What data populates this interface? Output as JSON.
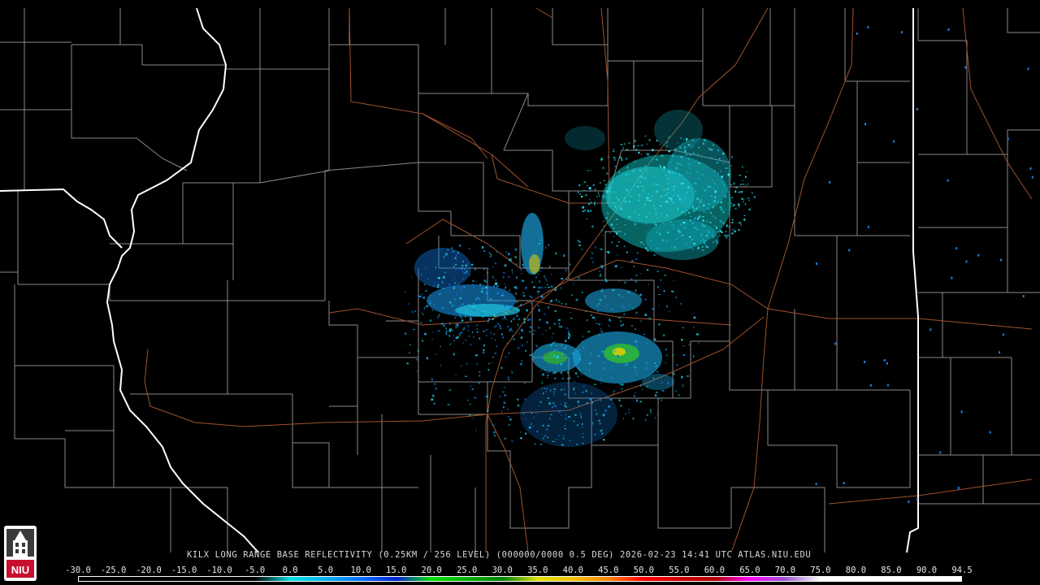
{
  "radar": {
    "header": "KILX LONG RANGE BASE REFLECTIVITY (0.25KM / 256 LEVEL) (000000/0000 0.5 DEG) 2026-02-23 14:41 UTC  ATLAS.NIU.EDU",
    "scale_values": [
      "-30.0",
      "-25.0",
      "-20.0",
      "-15.0",
      "-10.0",
      "-5.0",
      "0.0",
      "5.0",
      "10.0",
      "15.0",
      "20.0",
      "25.0",
      "30.0",
      "35.0",
      "40.0",
      "45.0",
      "50.0",
      "55.0",
      "60.0",
      "65.0",
      "70.0",
      "75.0",
      "80.0",
      "85.0",
      "90.0",
      "94.5"
    ],
    "scale_colors": [
      "#000000",
      "#000000",
      "#000000",
      "#000000",
      "#000000",
      "#000000",
      "#00e0e0",
      "#00b0f0",
      "#0070ff",
      "#0020d0",
      "#00e000",
      "#00b000",
      "#008000",
      "#e0e000",
      "#f0c000",
      "#ff8000",
      "#ff0000",
      "#d00000",
      "#b00000",
      "#ff00ff",
      "#9955cc",
      "#ffffff",
      "#ffffff",
      "#ffffff",
      "#ffffff"
    ],
    "map_colors": {
      "background": "#000000",
      "county": "#8a8a8a",
      "state": "#ffffff",
      "highway": "#a0522d"
    }
  },
  "logo": {
    "icon": "niu-tower-logo",
    "text": "NIU",
    "color": "#c8102e"
  }
}
